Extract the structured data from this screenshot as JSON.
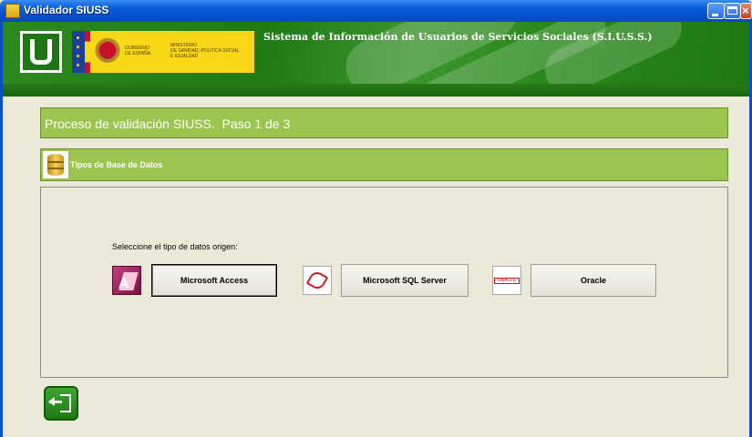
{
  "window": {
    "title": "Validador SIUSS",
    "controls": {
      "minimize": "minimize-icon",
      "maximize": "maximize-icon",
      "close": "close-icon"
    }
  },
  "header": {
    "gov_line1": "GOBIERNO\nDE ESPAÑA",
    "gov_line2": "MINISTERIO\nDE SANIDAD, POLÍTICA SOCIAL\nE IGUALDAD",
    "system_title": "Sistema de Información de Usuarios de Servicios Sociales (S.I.U.S.S.)"
  },
  "step": {
    "title": "Proceso de validación SIUSS.  Paso 1 de 3"
  },
  "section": {
    "title": "Tipos de Base de Datos",
    "icon": "database-icon"
  },
  "main": {
    "prompt": "Seleccione el tipo de datos origen:",
    "options": [
      {
        "label": "Microsoft Access",
        "icon": "access-icon"
      },
      {
        "label": "Microsoft SQL Server",
        "icon": "sql-server-icon"
      },
      {
        "label": "Oracle",
        "icon": "oracle-icon",
        "logo_text": "ORACLE"
      }
    ]
  },
  "footer": {
    "exit_icon": "exit-icon"
  },
  "colors": {
    "header_green": "#1f7a14",
    "panel_green": "#9bc54e",
    "titlebar_blue": "#0a5fd8",
    "window_bg": "#ece9d8"
  }
}
